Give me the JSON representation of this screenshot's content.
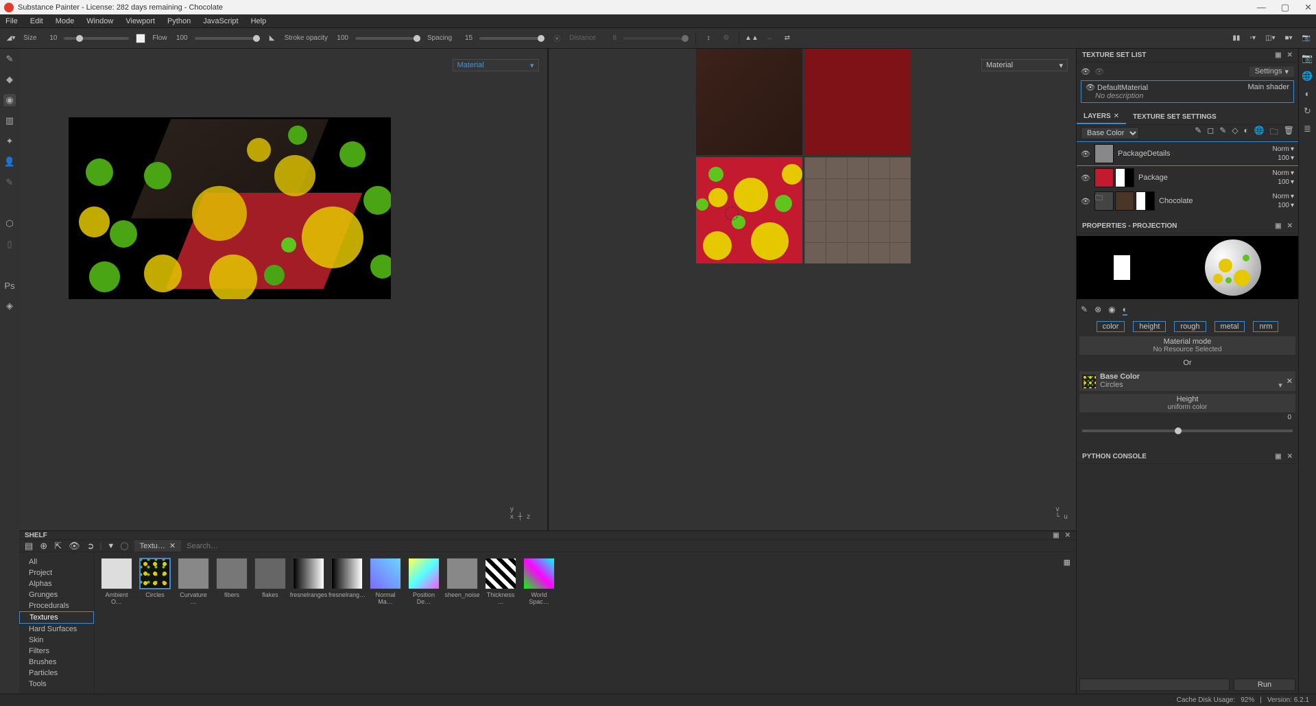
{
  "title": "Substance Painter - License: 282 days remaining - Chocolate",
  "menus": [
    "File",
    "Edit",
    "Mode",
    "Window",
    "Viewport",
    "Python",
    "JavaScript",
    "Help"
  ],
  "toolbar": {
    "size": {
      "label": "Size",
      "value": "10"
    },
    "flow": {
      "label": "Flow",
      "value": "100"
    },
    "stroke_opacity": {
      "label": "Stroke opacity",
      "value": "100"
    },
    "spacing": {
      "label": "Spacing",
      "value": "15"
    },
    "distance": {
      "label": "Distance",
      "value": "8"
    }
  },
  "viewport_left_dropdown": "Material",
  "viewport_right_dropdown": "Material",
  "shelf": {
    "title": "SHELF",
    "tab": "Textu…",
    "search_placeholder": "Search…",
    "categories": [
      "All",
      "Project",
      "Alphas",
      "Grunges",
      "Procedurals",
      "Textures",
      "Hard Surfaces",
      "Skin",
      "Filters",
      "Brushes",
      "Particles",
      "Tools"
    ],
    "selected_category": "Textures",
    "items": [
      "Ambient O…",
      "Circles",
      "Curvature …",
      "fibers",
      "flakes",
      "fresnelranges",
      "fresnelrang…",
      "Normal Ma…",
      "Position De…",
      "sheen_noise",
      "Thickness …",
      "World Spac…"
    ],
    "selected_item": "Circles"
  },
  "texture_set_list": {
    "title": "TEXTURE SET LIST",
    "settings_btn": "Settings",
    "set_name": "DefaultMaterial",
    "set_shader": "Main shader",
    "set_desc": "No description"
  },
  "layers_panel": {
    "tab_layers": "LAYERS",
    "tab_settings": "TEXTURE SET SETTINGS",
    "channel": "Base Color",
    "layers": [
      {
        "name": "PackageDetails",
        "blend": "Norm",
        "opacity": "100"
      },
      {
        "name": "Package",
        "blend": "Norm",
        "opacity": "100"
      },
      {
        "name": "Chocolate",
        "blend": "Norm",
        "opacity": "100"
      }
    ]
  },
  "properties": {
    "title": "PROPERTIES - PROJECTION",
    "pills": [
      "color",
      "height",
      "rough",
      "metal",
      "nrm"
    ],
    "material_mode": "Material mode",
    "no_resource": "No Resource Selected",
    "or": "Or",
    "base_color_label": "Base Color",
    "base_color_value": "Circles",
    "height_label": "Height",
    "height_value": "uniform color",
    "height_num": "0"
  },
  "console": {
    "title": "PYTHON CONSOLE",
    "run": "Run"
  },
  "status": {
    "cache": "Cache Disk Usage:",
    "cache_val": "92%",
    "version": "Version: 6.2.1"
  }
}
